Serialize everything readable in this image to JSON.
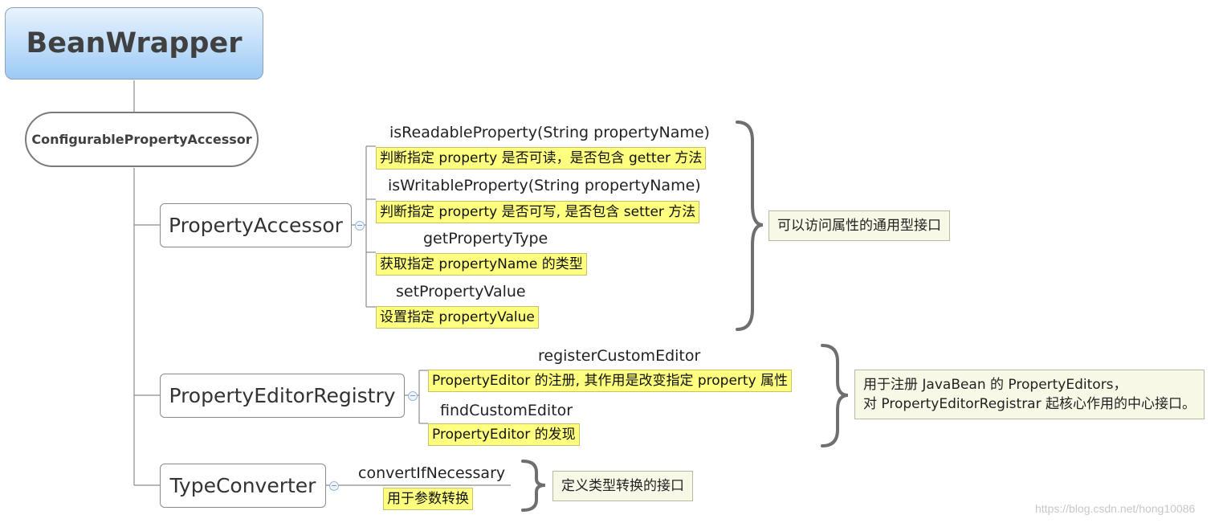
{
  "root": {
    "title": "BeanWrapper"
  },
  "parent": {
    "title": "ConfigurablePropertyAccessor"
  },
  "branches": [
    {
      "title": "PropertyAccessor",
      "methods": [
        {
          "name": "isReadableProperty(String propertyName)",
          "note": "判断指定 property 是否可读，是否包含 getter 方法"
        },
        {
          "name": "isWritableProperty(String propertyName)",
          "note": "判断指定 property 是否可写, 是否包含 setter 方法"
        },
        {
          "name": "getPropertyType",
          "note": "获取指定 propertyName 的类型"
        },
        {
          "name": "setPropertyValue",
          "note": "设置指定 propertyValue"
        }
      ],
      "summary": [
        "可以访问属性的通用型接口"
      ]
    },
    {
      "title": "PropertyEditorRegistry",
      "methods": [
        {
          "name": "registerCustomEditor",
          "note": "PropertyEditor 的注册, 其作用是改变指定 property 属性"
        },
        {
          "name": "findCustomEditor",
          "note": "PropertyEditor 的发现"
        }
      ],
      "summary": [
        "用于注册 JavaBean 的 PropertyEditors，",
        "对 PropertyEditorRegistrar 起核心作用的中心接口。"
      ]
    },
    {
      "title": "TypeConverter",
      "methods": [
        {
          "name": "convertIfNecessary",
          "note": "用于参数转换"
        }
      ],
      "summary": [
        "定义类型转换的接口"
      ]
    }
  ],
  "watermark": "https://blog.csdn.net/hong10086",
  "colors": {
    "note_bg": "#ffff7f",
    "root_gradient_top": "#e9f3fd",
    "root_gradient_bottom": "#9ccaf5",
    "summary_bg": "#f8f8e6"
  }
}
